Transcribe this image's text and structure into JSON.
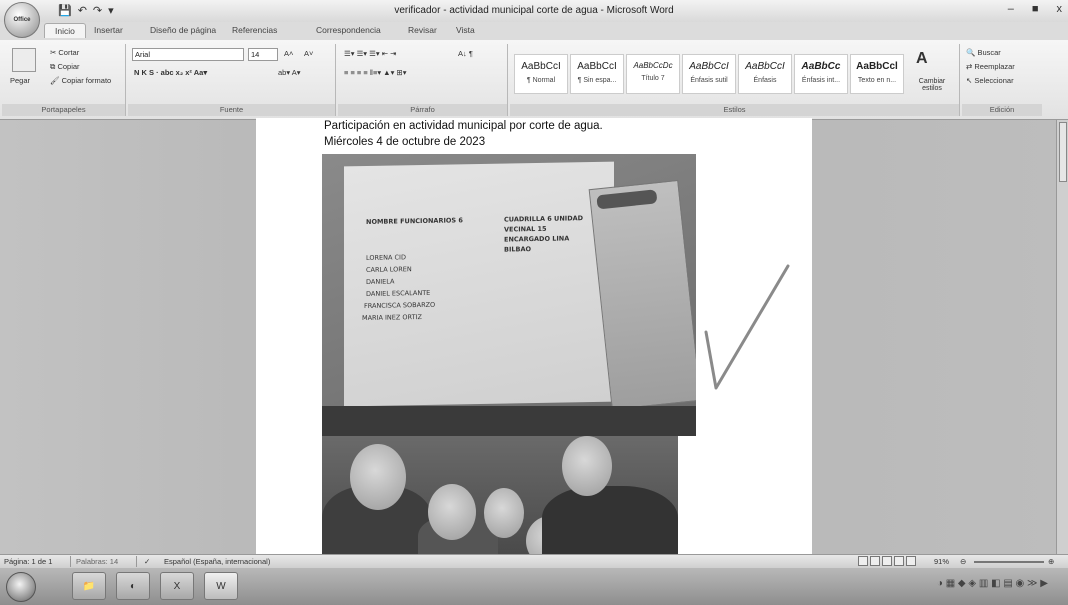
{
  "window": {
    "title": "verificador - actividad municipal corte de agua - Microsoft Word",
    "office_button_label": "Office",
    "controls": {
      "minimize": "–",
      "maximize": "■",
      "close": "x"
    },
    "qat": [
      "💾",
      "↶",
      "↷",
      "▾"
    ]
  },
  "tabs": [
    {
      "label": "Inicio",
      "active": true
    },
    {
      "label": "Insertar"
    },
    {
      "label": "Diseño de página"
    },
    {
      "label": "Referencias"
    },
    {
      "label": "Correspondencia"
    },
    {
      "label": "Revisar"
    },
    {
      "label": "Vista"
    }
  ],
  "ribbon": {
    "clipboard": {
      "paste": "Pegar",
      "cut": "Cortar",
      "copy": "Copiar",
      "format_painter": "Copiar formato",
      "group": "Portapapeles"
    },
    "font": {
      "family": "Arial",
      "size": "14",
      "grow": "A˄",
      "shrink": "A˅",
      "format_buttons": "N K S · abc x₂ x² Aa▾",
      "color_buttons": "ab▾ A▾",
      "group": "Fuente"
    },
    "paragraph": {
      "list_buttons": "☰▾ ☰▾ ☰▾ ⇤ ⇥",
      "sort_buttons": "A↓ ¶",
      "align_buttons": "≡ ≡ ≡ ≡ ‖≡▾ ▲▾ ⊞▾",
      "group": "Párrafo"
    },
    "styles": {
      "items": [
        {
          "sample": "AaBbCcI",
          "name": "¶ Normal"
        },
        {
          "sample": "AaBbCcI",
          "name": "¶ Sin espa..."
        },
        {
          "sample": "AaBbCcDc",
          "name": "Título 7"
        },
        {
          "sample": "AaBbCcI",
          "name": "Énfasis sutil"
        },
        {
          "sample": "AaBbCcI",
          "name": "Énfasis"
        },
        {
          "sample": "AaBbCc",
          "name": "Énfasis int..."
        },
        {
          "sample": "AaBbCcl",
          "name": "Texto en n..."
        }
      ],
      "change_styles": "Cambiar estilos",
      "group": "Estilos"
    },
    "editing": {
      "find": "Buscar",
      "replace": "Reemplazar",
      "select": "Seleccionar",
      "group": "Edición"
    }
  },
  "document": {
    "line1": "Participación en actividad municipal por corte de agua.",
    "line2": "Miércoles 4 de octubre de 2023",
    "whiteboard": {
      "col1_header": "NOMBRE FUNCIONARIOS 6",
      "col2_header_lines": [
        "CUADRILLA 6 UNIDAD",
        "VECINAL 15",
        "ENCARGADO LINA",
        "BILBAO"
      ],
      "names": [
        "LORENA CID",
        "CARLA LOREN",
        "DANIELA",
        "DANIEL ESCALANTE",
        "FRANCISCA SOBARZO",
        "MARIA INEZ ORTIZ"
      ]
    }
  },
  "statusbar": {
    "page": "Página: 1 de 1",
    "words": "Palabras: 14",
    "language": "Español (España, internacional)",
    "zoom": "91%",
    "zoom_out": "⊖",
    "zoom_in": "⊕"
  },
  "taskbar": {
    "apps": [
      {
        "icon": "explorer-icon",
        "glyph": "📁"
      },
      {
        "icon": "browser-icon",
        "glyph": "◐"
      },
      {
        "icon": "excel-icon",
        "glyph": "X"
      },
      {
        "icon": "word-icon",
        "glyph": "W",
        "active": true
      }
    ],
    "tray_icons": "◑ ▦ ◆ ◈ ▥ ◧ ▤ ◉ ≫ ▶"
  }
}
